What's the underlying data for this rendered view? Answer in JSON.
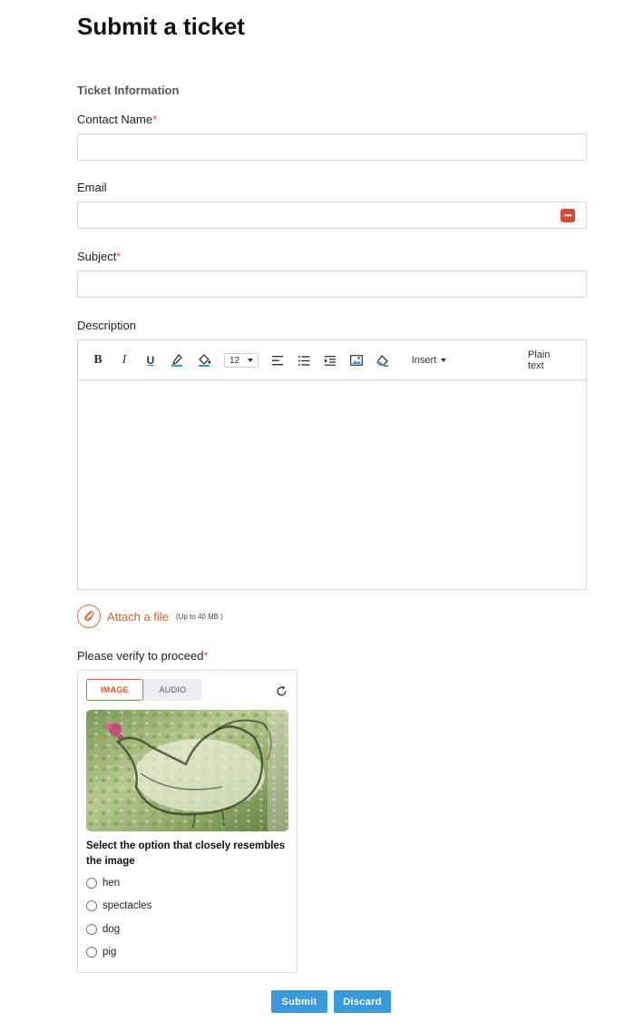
{
  "page": {
    "title": "Submit a ticket",
    "section": "Ticket Information"
  },
  "form": {
    "contact_name": {
      "label": "Contact Name",
      "required_mark": "*",
      "value": "",
      "placeholder": ""
    },
    "email": {
      "label": "Email",
      "value": "",
      "placeholder": "",
      "password_manager_icon": "dots-icon"
    },
    "subject": {
      "label": "Subject",
      "required_mark": "*",
      "value": "",
      "placeholder": ""
    },
    "description": {
      "label": "Description",
      "toolbar": {
        "bold": "B",
        "italic": "I",
        "underline": "U",
        "font_size": "12",
        "insert": "Insert",
        "plain_text": "Plain text"
      },
      "value": ""
    },
    "attachment": {
      "label": "Attach a file",
      "limit": "(Up to 40 MB )"
    }
  },
  "captcha": {
    "label": "Please verify to proceed",
    "required_mark": "*",
    "tabs": [
      "IMAGE",
      "AUDIO"
    ],
    "active_tab": "IMAGE",
    "question": "Select the option that closely resembles the image",
    "options": [
      "hen",
      "spectacles",
      "dog",
      "pig"
    ]
  },
  "actions": {
    "submit": "Submit",
    "discard": "Discard"
  },
  "colors": {
    "accent_orange": "#d4622c",
    "button_blue": "#3a9ad9",
    "required_red": "#d9534f"
  }
}
